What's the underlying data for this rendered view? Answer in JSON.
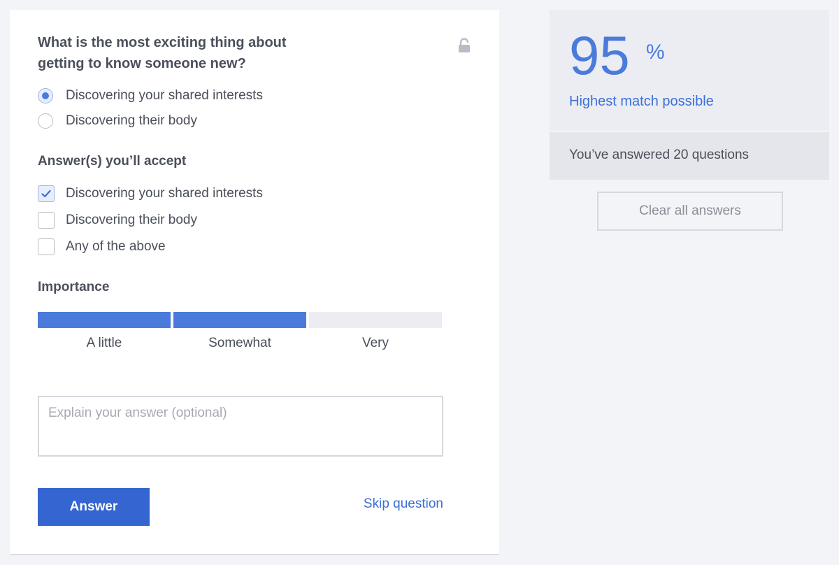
{
  "question": {
    "text": "What is the most exciting thing about getting to know someone new?",
    "locked_icon": "lock-icon",
    "your_answer_options": [
      {
        "label": "Discovering your shared interests",
        "selected": true
      },
      {
        "label": "Discovering their body",
        "selected": false
      }
    ]
  },
  "accept": {
    "heading": "Answer(s) you’ll accept",
    "options": [
      {
        "label": "Discovering your shared interests",
        "checked": true
      },
      {
        "label": "Discovering their body",
        "checked": false
      },
      {
        "label": "Any of the above",
        "checked": false
      }
    ]
  },
  "importance": {
    "heading": "Importance",
    "levels": [
      "A little",
      "Somewhat",
      "Very"
    ],
    "selected_level": 2
  },
  "explain": {
    "placeholder": "Explain your answer (optional)",
    "value": ""
  },
  "actions": {
    "answer_label": "Answer",
    "skip_label": "Skip question"
  },
  "match": {
    "percent": "95",
    "percent_sign": "%",
    "caption": "Highest match possible"
  },
  "answered": {
    "text": "You’ve answered 20 questions"
  },
  "clear": {
    "label": "Clear all answers"
  },
  "colors": {
    "accent": "#4a7bdb",
    "button": "#3465d0",
    "text": "#4a4f5a",
    "page_bg": "#f3f4f7"
  }
}
